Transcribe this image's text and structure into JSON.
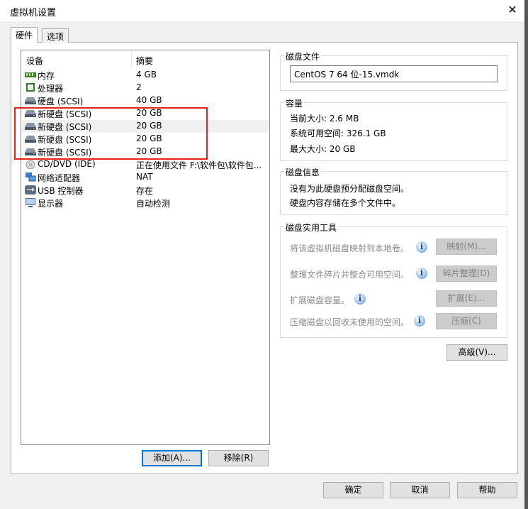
{
  "window": {
    "title": "虚拟机设置",
    "close": "✕"
  },
  "tabs": [
    {
      "label": "硬件",
      "selected": true
    },
    {
      "label": "选项",
      "selected": false
    }
  ],
  "devices": {
    "col_device": "设备",
    "col_summary": "摘要",
    "rows": [
      {
        "name": "内存",
        "summary": "4 GB",
        "icon": "memory-icon"
      },
      {
        "name": "处理器",
        "summary": "2",
        "icon": "cpu-icon"
      },
      {
        "name": "硬盘 (SCSI)",
        "summary": "40 GB",
        "icon": "harddisk-icon"
      },
      {
        "name": "新硬盘 (SCSI)",
        "summary": "20 GB",
        "icon": "harddisk-icon"
      },
      {
        "name": "新硬盘 (SCSI)",
        "summary": "20 GB",
        "icon": "harddisk-icon",
        "selected": true
      },
      {
        "name": "新硬盘 (SCSI)",
        "summary": "20 GB",
        "icon": "harddisk-icon"
      },
      {
        "name": "新硬盘 (SCSI)",
        "summary": "20 GB",
        "icon": "harddisk-icon"
      },
      {
        "name": "CD/DVD (IDE)",
        "summary": "正在使用文件 F:\\软件包\\软件包...",
        "icon": "cd-icon"
      },
      {
        "name": "网络适配器",
        "summary": "NAT",
        "icon": "network-icon"
      },
      {
        "name": "USB 控制器",
        "summary": "存在",
        "icon": "usb-icon"
      },
      {
        "name": "显示器",
        "summary": "自动检测",
        "icon": "monitor-icon"
      }
    ],
    "add": "添加(A)...",
    "remove": "移除(R)"
  },
  "disk_file": {
    "label": "磁盘文件",
    "value": "CentOS 7 64 位-15.vmdk"
  },
  "capacity": {
    "label": "容量",
    "current": "当前大小: 2.6 MB",
    "available": "系统可用空间: 326.1 GB",
    "max": "最大大小: 20 GB"
  },
  "disk_info": {
    "label": "磁盘信息",
    "line1": "没有为此硬盘预分配磁盘空间。",
    "line2": "硬盘内容存储在多个文件中。"
  },
  "utilities": {
    "label": "磁盘实用工具",
    "map_text": "将该虚拟机磁盘映射到本地卷。",
    "map_btn": "映射(M)...",
    "defrag_text": "整理文件碎片并整合可用空间。",
    "defrag_btn": "碎片整理(D)",
    "expand_text": "扩展磁盘容量。",
    "expand_btn": "扩展(E)...",
    "compact_text": "压缩磁盘以回收未使用的空间。",
    "compact_btn": "压缩(C)"
  },
  "advanced": "高级(V)...",
  "footer": {
    "ok": "确定",
    "cancel": "取消",
    "help": "帮助"
  },
  "colors": {
    "highlight": "#e8221c",
    "accent": "#0078d7"
  }
}
